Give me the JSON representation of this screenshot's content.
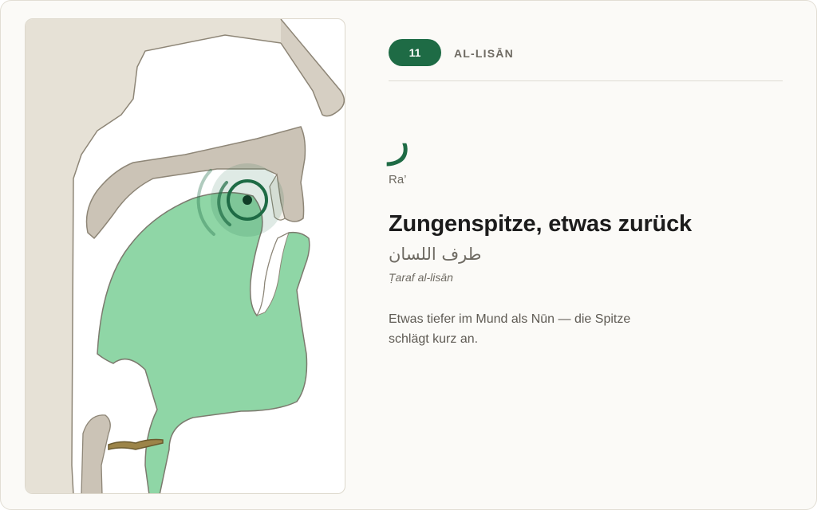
{
  "header": {
    "number": "11",
    "section": "AL-LISĀN"
  },
  "letter": {
    "glyph": "ر",
    "name": "Ra’"
  },
  "articulation": {
    "title": "Zungenspitze, etwas zurück",
    "arabic": "طرف اللسان",
    "transliteration": "Ṭaraf al-lisān",
    "description": "Etwas tiefer im Mund als Nūn — die Spitze schlägt kurz an."
  },
  "colors": {
    "accent": "#1e6b45",
    "tongue": "#8fd6a6",
    "tissue": "#c9c1b4",
    "background": "#fbfaf7"
  },
  "figure": {
    "icon": "mouth-cross-section-diagram",
    "highlight_icon": "articulation-point-icon"
  }
}
